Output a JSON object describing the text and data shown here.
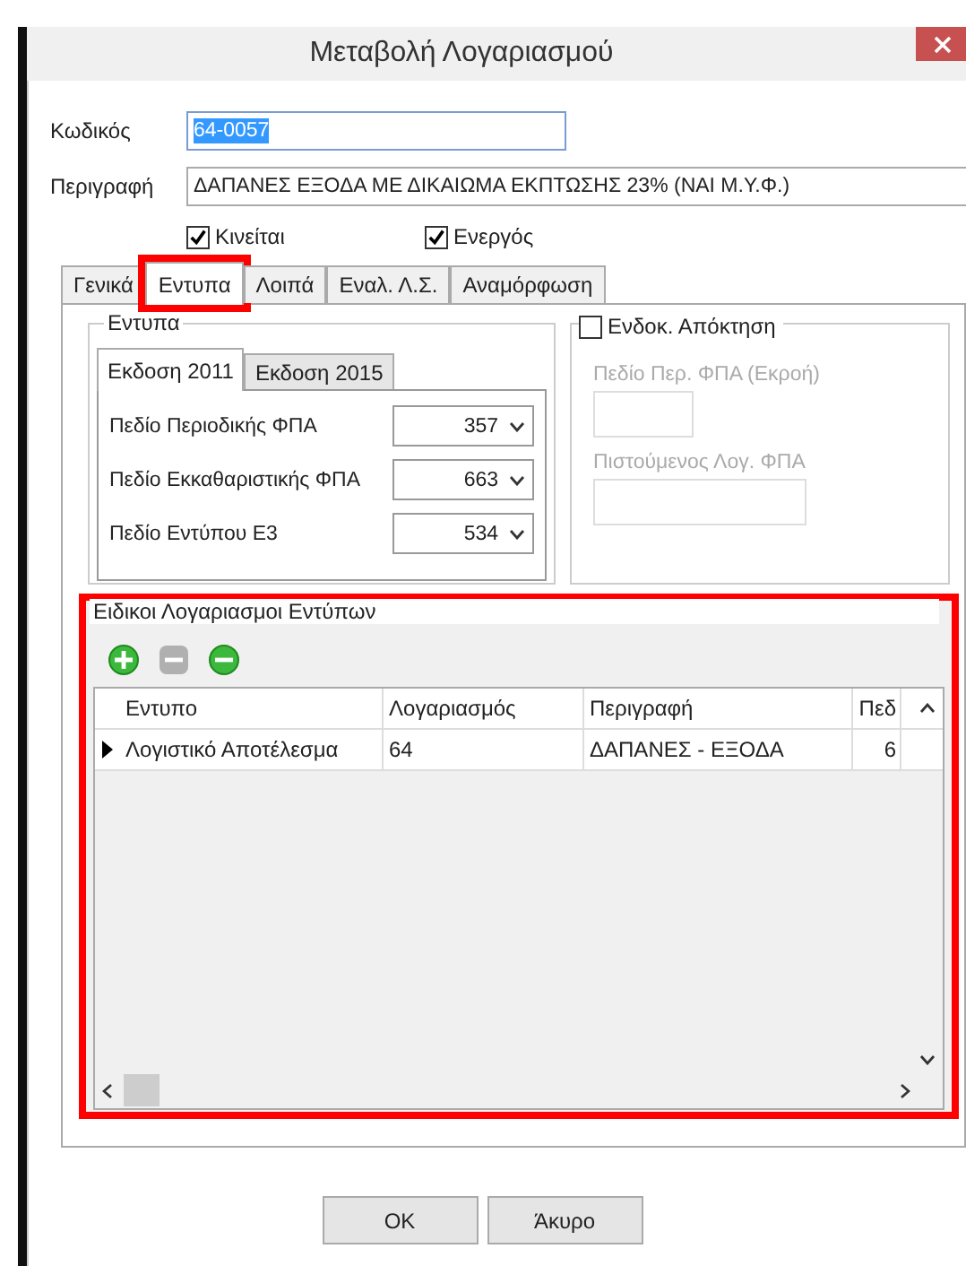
{
  "window": {
    "title": "Μεταβολή Λογαριασμού"
  },
  "fields": [
    {
      "label": "Κωδικός",
      "value": "64-0057",
      "text_selected": true
    },
    {
      "label": "Περιγραφή",
      "value": "ΔΑΠΑΝΕΣ ΕΞΟΔΑ ΜΕ ΔΙΚΑΙΩΜΑ ΕΚΠΤΩΣΗΣ 23% (ΝΑΙ Μ.Υ.Φ.)",
      "text_selected": false
    }
  ],
  "checkboxes": [
    {
      "label": "Κινείται",
      "checked": true
    },
    {
      "label": "Ενεργός",
      "checked": true
    }
  ],
  "tabs": [
    {
      "label": "Γενικά",
      "selected": false,
      "highlighted": false
    },
    {
      "label": "Εντυπα",
      "selected": true,
      "highlighted": true
    },
    {
      "label": "Λοιπά",
      "selected": false,
      "highlighted": false
    },
    {
      "label": "Εναλ. Λ.Σ.",
      "selected": false,
      "highlighted": false
    },
    {
      "label": "Αναμόρφωση",
      "selected": false,
      "highlighted": false
    }
  ],
  "forms_group": {
    "legend": "Εντυπα",
    "tabs": [
      {
        "label": "Εκδοση 2011",
        "selected": true
      },
      {
        "label": "Εκδοση 2015",
        "selected": false
      }
    ],
    "rows": [
      {
        "label": "Πεδίο Περιοδικής ΦΠΑ",
        "value": "357"
      },
      {
        "label": "Πεδίο Εκκαθαριστικής ΦΠΑ",
        "value": "663"
      },
      {
        "label": "Πεδίο Εντύπου Ε3",
        "value": "534"
      }
    ]
  },
  "acquisition": {
    "label": "Ενδοκ. Απόκτηση",
    "checked": false,
    "fields": [
      {
        "label": "Πεδίο Περ. ΦΠΑ (Εκροή)",
        "disabled": true
      },
      {
        "label": "Πιστούμενος Λογ. ΦΠΑ",
        "disabled": true
      }
    ]
  },
  "special_accounts": {
    "legend": "Ειδικοι Λογαριασμοι Εντύπων",
    "highlighted": true,
    "toolbar": [
      {
        "kind": "add",
        "disabled": false
      },
      {
        "kind": "edit",
        "disabled": true
      },
      {
        "kind": "remove",
        "disabled": false
      }
    ],
    "columns": [
      "Εντυπο",
      "Λογαριασμός",
      "Περιγραφή",
      "Πεδ"
    ],
    "rows": [
      {
        "cells": [
          "Λογιστικό Αποτέλεσμα",
          "64",
          "ΔΑΠΑΝΕΣ - ΕΞΟΔΑ",
          "6"
        ],
        "selected": true
      }
    ]
  },
  "buttons": [
    {
      "label": "OK"
    },
    {
      "label": "Άκυρο"
    }
  ]
}
